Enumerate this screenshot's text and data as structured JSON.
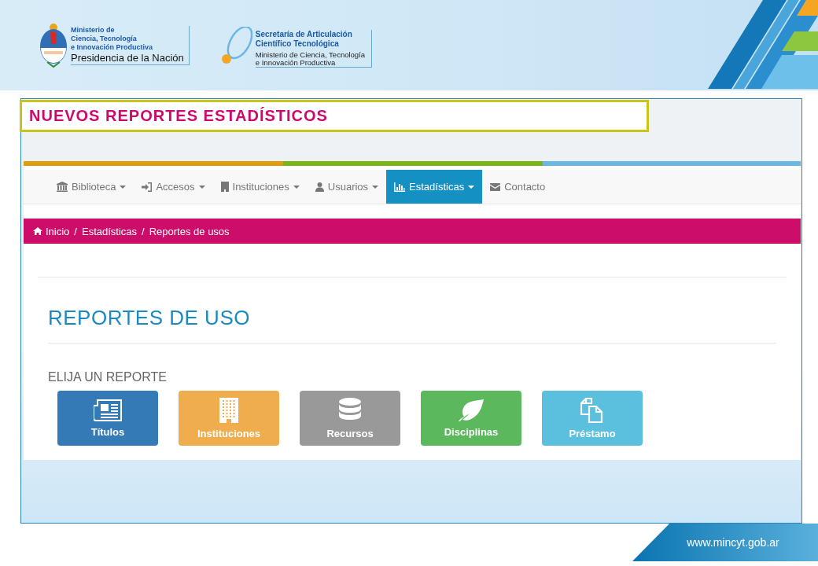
{
  "header": {
    "logo_left": {
      "lines": [
        "Ministerio de",
        "Ciencia, Tecnología",
        "e Innovación Productiva"
      ],
      "subtitle": "Presidencia de la Nación"
    },
    "logo_right": {
      "title_lines": [
        "Secretaría de Articulación",
        "Científico Tecnológica"
      ],
      "sub_lines": [
        "Ministerio de Ciencia, Tecnología",
        "e Innovación Productiva"
      ]
    }
  },
  "slide_title": "NUEVOS REPORTES ESTADÍSTICOS",
  "nav": [
    {
      "label": "Biblioteca",
      "kind": "bank",
      "dropdown": true,
      "selected": false
    },
    {
      "label": "Accesos",
      "kind": "signin",
      "dropdown": true,
      "selected": false
    },
    {
      "label": "Instituciones",
      "kind": "building",
      "dropdown": true,
      "selected": false
    },
    {
      "label": "Usuarios",
      "kind": "user",
      "dropdown": true,
      "selected": false
    },
    {
      "label": "Estadísticas",
      "kind": "chart",
      "dropdown": true,
      "selected": true
    },
    {
      "label": "Contacto",
      "kind": "mail",
      "dropdown": false,
      "selected": false
    }
  ],
  "breadcrumb": {
    "separator": "/",
    "items": [
      "Inicio",
      "Estadísticas",
      "Reportes de usos"
    ]
  },
  "heading": "REPORTES DE USO",
  "subheading": "ELIJA UN REPORTE",
  "reports": [
    {
      "label": "Títulos",
      "kind": "newspaper",
      "color": "#337ab7"
    },
    {
      "label": "Instituciones",
      "kind": "building",
      "color": "#f0ad4e"
    },
    {
      "label": "Recursos",
      "kind": "database",
      "color": "#999999"
    },
    {
      "label": "Disciplinas",
      "kind": "leaf",
      "color": "#5cb85c"
    },
    {
      "label": "Préstamo",
      "kind": "copy",
      "color": "#5bc0de"
    }
  ],
  "footer_url": "www.mincyt.gob.ar"
}
